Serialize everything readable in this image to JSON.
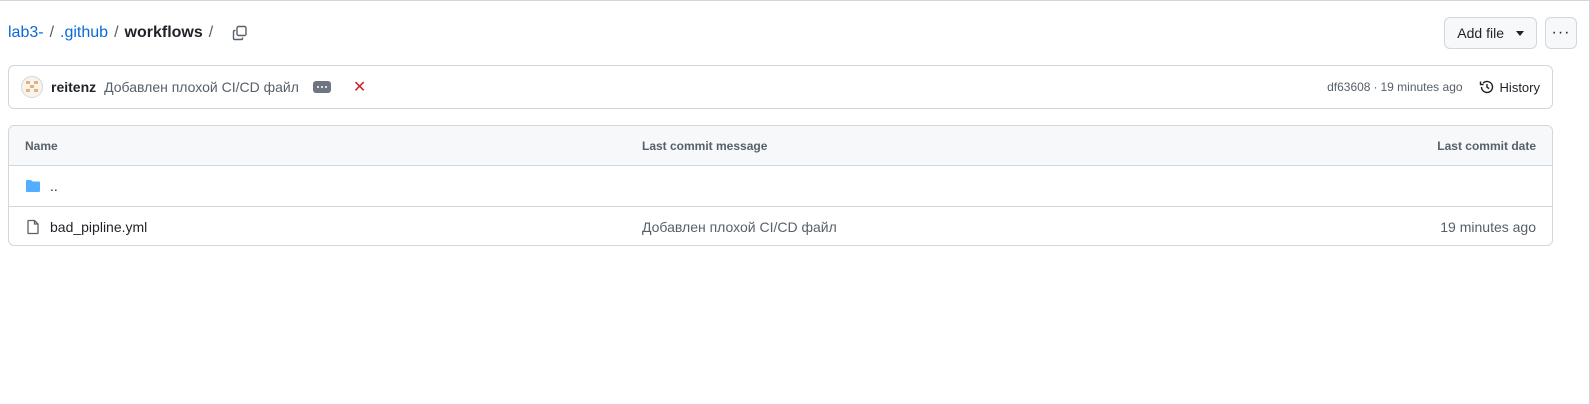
{
  "breadcrumb": {
    "repo": "lab3-",
    "folder": ".github",
    "current": "workflows",
    "sep": "/",
    "trailing_sep": "/"
  },
  "actions": {
    "add_file_label": "Add file",
    "more_label": "···"
  },
  "commit": {
    "author": "reitenz",
    "message": "Добавлен плохой CI/CD файл",
    "status_symbol": "✕",
    "sha": "df63608",
    "dot": "·",
    "time": "19 minutes ago",
    "history_label": "History"
  },
  "table": {
    "headers": {
      "name": "Name",
      "message": "Last commit message",
      "date": "Last commit date"
    },
    "rows": [
      {
        "name": "..",
        "message": "",
        "date": "",
        "icon": "folder-icon"
      },
      {
        "name": "bad_pipline.yml",
        "message": "Добавлен плохой CI/CD файл",
        "date": "19 minutes ago",
        "icon": "file-icon"
      }
    ]
  },
  "colors": {
    "link": "#0969da",
    "border": "#d0d7de",
    "header_bg": "#f6f8fa",
    "muted": "#57606a",
    "error": "#cf222e",
    "folder": "#54aeff"
  }
}
